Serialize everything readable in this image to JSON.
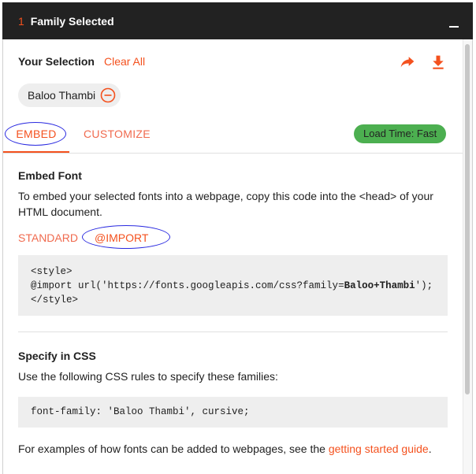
{
  "header": {
    "count": "1",
    "title": "Family Selected"
  },
  "selection": {
    "label": "Your Selection",
    "clear_all": "Clear All"
  },
  "chip": {
    "family": "Baloo Thambi"
  },
  "tabs": {
    "embed": "EMBED",
    "customize": "CUSTOMIZE",
    "load_time": "Load Time: Fast"
  },
  "embed_font": {
    "title": "Embed Font",
    "description": "To embed your selected fonts into a webpage, copy this code into the <head> of your HTML document.",
    "subtabs": {
      "standard": "STANDARD",
      "import": "@IMPORT"
    },
    "code": {
      "line1": "<style>",
      "line2_prefix": "@import url('https://fonts.googleapis.com/css?family=",
      "line2_bold": "Baloo+Thambi",
      "line2_suffix": "');",
      "line3": "</style>"
    }
  },
  "specify_css": {
    "title": "Specify in CSS",
    "description": "Use the following CSS rules to specify these families:",
    "code": "font-family: 'Baloo Thambi', cursive;"
  },
  "footer": {
    "text": "For examples of how fonts can be added to webpages, see the ",
    "link": "getting started guide",
    "end": "."
  },
  "colors": {
    "accent": "#f4511e",
    "header_bg": "#222222",
    "badge_green": "#4caf50",
    "annotation": "#2a2ae0"
  }
}
